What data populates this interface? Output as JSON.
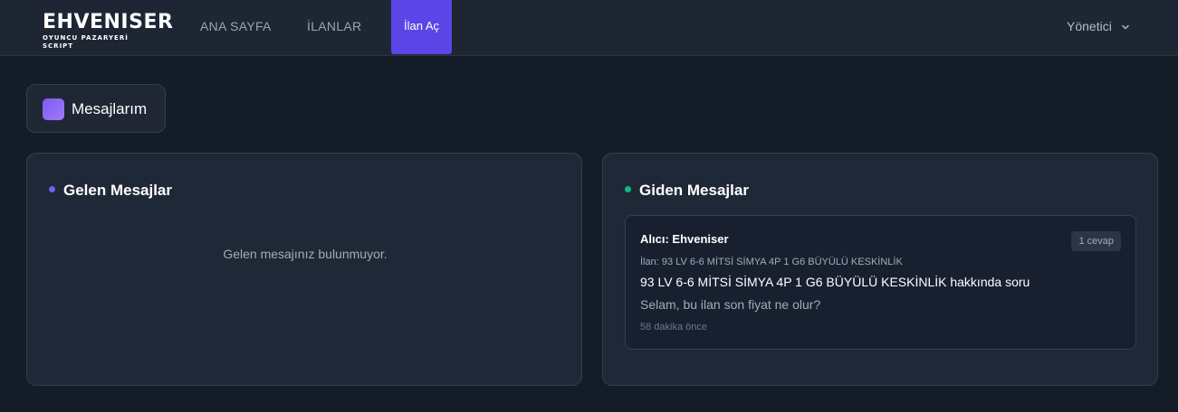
{
  "brand": {
    "title": "EHVENISER",
    "subtitle": "OYUNCU PAZARYERİ SCRIPT"
  },
  "nav": {
    "home": "ANA SAYFA",
    "listings": "İLANLAR",
    "create": "İlan Aç"
  },
  "user": {
    "name": "Yönetici"
  },
  "page": {
    "title": "Mesajlarım"
  },
  "inbox": {
    "title": "Gelen Mesajlar",
    "empty": "Gelen mesajınız bulunmuyor.",
    "dot_color": "#6366f1"
  },
  "outbox": {
    "title": "Giden Mesajlar",
    "dot_color": "#10b981",
    "messages": [
      {
        "to": "Alıcı: Ehveniser",
        "replies": "1 cevap",
        "listing": "İlan: 93 LV 6-6 MİTSİ SİMYA 4P 1 G6 BÜYÜLÜ KESKİNLİK",
        "subject": "93 LV 6-6 MİTSİ SİMYA 4P 1 G6 BÜYÜLÜ KESKİNLİK hakkında soru",
        "body": "Selam, bu ilan son fiyat ne olur?",
        "time": "58 dakika önce"
      }
    ]
  },
  "colors": {
    "accent": "#5b45e6",
    "background": "#141c28",
    "panel": "#1f2836"
  }
}
